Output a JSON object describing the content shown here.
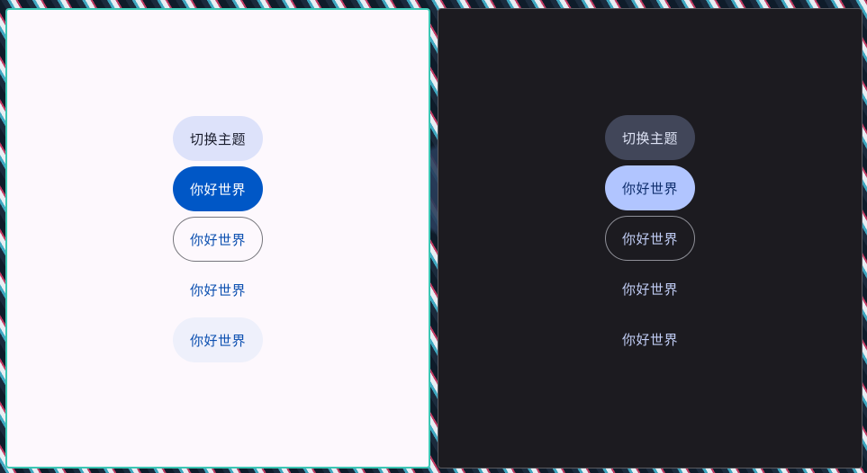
{
  "colors": {
    "light_window_bg": "#fdf8fd",
    "light_window_border": "#3cc7b4",
    "dark_window_bg": "#1c1b20",
    "light_primary": "#0057c6",
    "dark_primary": "#b1c5ff"
  },
  "light_window": {
    "toggle_theme_label": "切换主题",
    "filled_button_label": "你好世界",
    "outlined_button_label": "你好世界",
    "text_button_label": "你好世界",
    "elevated_button_label": "你好世界"
  },
  "dark_window": {
    "toggle_theme_label": "切换主题",
    "filled_button_label": "你好世界",
    "outlined_button_label": "你好世界",
    "text_button_label": "你好世界",
    "elevated_button_label": "你好世界"
  }
}
